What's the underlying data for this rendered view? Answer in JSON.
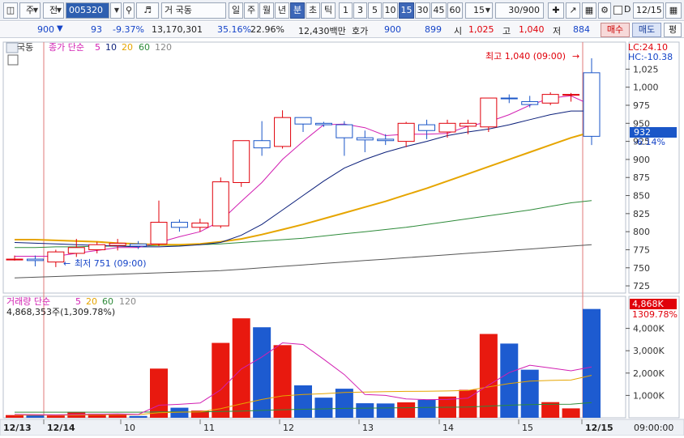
{
  "toolbar": {
    "tab_label": "주",
    "prev_label": "전",
    "code_value": "005320",
    "stock_name": "국동",
    "stock_prefix": "거",
    "period_tabs": [
      "일",
      "주",
      "월",
      "년",
      "분",
      "초",
      "틱"
    ],
    "active_period": "분",
    "interval_buttons": [
      "1",
      "3",
      "5",
      "10",
      "15",
      "30",
      "45",
      "60"
    ],
    "active_interval": "15",
    "interval_select": "15",
    "count_value": "30/900",
    "date_value": "12/15",
    "date_checkbox_label": "D",
    "last_button": "평"
  },
  "info": {
    "price": "900",
    "change": "93",
    "change_pct": "-9.37%",
    "volume": "13,170,301",
    "volume_ratio": "35.16%",
    "turnover": "22.96%",
    "amount": "12,430백만",
    "quote_label": "호가",
    "ask": "900",
    "bid": "899",
    "open_label": "시",
    "open": "1,025",
    "high_label": "고",
    "high": "1,040",
    "low_label": "저",
    "low": "884",
    "buy_label": "매수",
    "sell_label": "매도"
  },
  "price_panel": {
    "stock_tag": "국동",
    "legend_prefix": "종가 단순",
    "ma_labels": [
      "5",
      "10",
      "20",
      "60",
      "120"
    ],
    "lc_label": "LC:24.10",
    "hc_label": "HC:-10.38",
    "high_annotation": "최고 1,040 (09:00)",
    "low_annotation": "최저 751 (09:00)",
    "current_price_tag": "932",
    "current_pct_tag": "-6.14%"
  },
  "volume_panel": {
    "legend_prefix": "거래량 단순",
    "ma_labels": [
      "5",
      "20",
      "60",
      "120"
    ],
    "volume_text": "4,868,353주(1,309.78%)",
    "current_volume_tag": "4,868K",
    "current_pct_tag": "1309.78%"
  },
  "x_axis": {
    "labels": [
      "12/13",
      "12/14",
      "10",
      "11",
      "12",
      "13",
      "14",
      "15",
      "12/15",
      "09:00:00"
    ]
  },
  "colors": {
    "up": "#e0000a",
    "down": "#1a56c8",
    "ma5": "#d21fb2",
    "ma10": "#0b1f7a",
    "ma20": "#e6a500",
    "ma60": "#2e8b3a",
    "ma120": "#555555",
    "vol_up": "#e8190f",
    "vol_down": "#1d5bd0"
  },
  "chart_data": {
    "type": "candlestick",
    "price_axis": {
      "ylim": [
        715,
        1040
      ],
      "ticks": [
        725,
        750,
        775,
        800,
        825,
        850,
        875,
        900,
        925,
        950,
        975,
        1000,
        1025
      ]
    },
    "volume_axis": {
      "ylim": [
        0,
        5000
      ],
      "ticks": [
        "1,000K",
        "2,000K",
        "3,000K",
        "4,000K"
      ]
    },
    "candles": [
      {
        "o": 762,
        "h": 767,
        "l": 760,
        "c": 762,
        "v": 120
      },
      {
        "o": 762,
        "h": 767,
        "l": 752,
        "c": 760,
        "v": 110
      },
      {
        "o": 758,
        "h": 775,
        "l": 751,
        "c": 772,
        "v": 100
      },
      {
        "o": 770,
        "h": 790,
        "l": 765,
        "c": 778,
        "v": 260
      },
      {
        "o": 775,
        "h": 786,
        "l": 770,
        "c": 782,
        "v": 180
      },
      {
        "o": 781,
        "h": 790,
        "l": 774,
        "c": 784,
        "v": 160
      },
      {
        "o": 783,
        "h": 787,
        "l": 776,
        "c": 780,
        "v": 80
      },
      {
        "o": 783,
        "h": 843,
        "l": 780,
        "c": 813,
        "v": 2200
      },
      {
        "o": 813,
        "h": 817,
        "l": 800,
        "c": 806,
        "v": 450
      },
      {
        "o": 806,
        "h": 818,
        "l": 800,
        "c": 812,
        "v": 320
      },
      {
        "o": 808,
        "h": 875,
        "l": 805,
        "c": 869,
        "v": 3350
      },
      {
        "o": 868,
        "h": 925,
        "l": 862,
        "c": 926,
        "v": 4450
      },
      {
        "o": 926,
        "h": 953,
        "l": 905,
        "c": 916,
        "v": 4050
      },
      {
        "o": 918,
        "h": 968,
        "l": 915,
        "c": 958,
        "v": 3250
      },
      {
        "o": 958,
        "h": 958,
        "l": 938,
        "c": 949,
        "v": 1450
      },
      {
        "o": 950,
        "h": 952,
        "l": 945,
        "c": 948,
        "v": 900
      },
      {
        "o": 948,
        "h": 953,
        "l": 905,
        "c": 930,
        "v": 1300
      },
      {
        "o": 930,
        "h": 940,
        "l": 910,
        "c": 927,
        "v": 650
      },
      {
        "o": 928,
        "h": 935,
        "l": 920,
        "c": 926,
        "v": 640
      },
      {
        "o": 925,
        "h": 952,
        "l": 917,
        "c": 950,
        "v": 690
      },
      {
        "o": 948,
        "h": 955,
        "l": 928,
        "c": 940,
        "v": 800
      },
      {
        "o": 938,
        "h": 955,
        "l": 930,
        "c": 950,
        "v": 950
      },
      {
        "o": 946,
        "h": 955,
        "l": 935,
        "c": 950,
        "v": 1250
      },
      {
        "o": 945,
        "h": 985,
        "l": 938,
        "c": 985,
        "v": 3750
      },
      {
        "o": 985,
        "h": 990,
        "l": 978,
        "c": 984,
        "v": 3320
      },
      {
        "o": 980,
        "h": 988,
        "l": 972,
        "c": 976,
        "v": 2150
      },
      {
        "o": 978,
        "h": 993,
        "l": 975,
        "c": 990,
        "v": 700
      },
      {
        "o": 990,
        "h": 992,
        "l": 980,
        "c": 990,
        "v": 420
      },
      {
        "o": 1020,
        "h": 1040,
        "l": 920,
        "c": 932,
        "v": 4868
      }
    ],
    "ma5": [
      766,
      766,
      766,
      770,
      774,
      778,
      778,
      785,
      793,
      800,
      815,
      842,
      868,
      900,
      925,
      948,
      949,
      944,
      933,
      935,
      935,
      936,
      946,
      952,
      962,
      975,
      985,
      988,
      975
    ],
    "ma10": [
      785,
      784,
      783,
      782,
      781,
      780,
      779,
      779,
      780,
      782,
      785,
      795,
      810,
      830,
      850,
      870,
      888,
      900,
      910,
      918,
      925,
      933,
      938,
      942,
      948,
      955,
      962,
      967,
      967
    ],
    "ma20": [
      789,
      789,
      788,
      787,
      786,
      784,
      783,
      782,
      782,
      783,
      786,
      790,
      796,
      803,
      810,
      818,
      826,
      834,
      842,
      851,
      860,
      870,
      880,
      890,
      900,
      910,
      920,
      930,
      938
    ],
    "ma60": [
      778,
      778,
      779,
      779,
      780,
      780,
      780,
      781,
      781,
      782,
      783,
      785,
      787,
      789,
      791,
      794,
      797,
      800,
      803,
      806,
      810,
      814,
      818,
      822,
      826,
      830,
      835,
      840,
      843
    ],
    "ma120": [
      736,
      737,
      738,
      739,
      740,
      741,
      742,
      743,
      744,
      745,
      746,
      748,
      750,
      752,
      754,
      756,
      758,
      760,
      762,
      764,
      766,
      768,
      770,
      772,
      774,
      776,
      778,
      780,
      782
    ],
    "vol_ma5": [
      150,
      140,
      130,
      150,
      160,
      170,
      150,
      560,
      600,
      660,
      1250,
      2180,
      2720,
      3350,
      3280,
      2620,
      1930,
      1040,
      1000,
      840,
      810,
      820,
      880,
      1460,
      2020,
      2350,
      2230,
      2100,
      2270
    ],
    "vol_ma20": [
      120,
      120,
      120,
      120,
      130,
      140,
      140,
      230,
      250,
      260,
      410,
      620,
      820,
      980,
      1040,
      1080,
      1130,
      1150,
      1170,
      1180,
      1190,
      1200,
      1220,
      1380,
      1530,
      1640,
      1670,
      1690,
      1900
    ],
    "vol_ma60": [
      250,
      250,
      250,
      250,
      250,
      250,
      250,
      260,
      260,
      260,
      280,
      300,
      330,
      360,
      380,
      400,
      420,
      430,
      440,
      450,
      460,
      470,
      480,
      520,
      560,
      590,
      600,
      610,
      680
    ]
  }
}
